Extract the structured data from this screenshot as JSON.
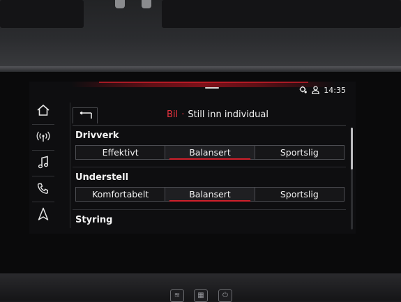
{
  "status": {
    "time": "14:35",
    "icons": [
      "gear-person-icon",
      "user-icon"
    ]
  },
  "sidebar": {
    "items": [
      {
        "name": "home",
        "icon": "home-icon"
      },
      {
        "name": "radio",
        "icon": "radio-signal-icon"
      },
      {
        "name": "media",
        "icon": "music-note-icon"
      },
      {
        "name": "phone",
        "icon": "phone-icon"
      },
      {
        "name": "navigation",
        "icon": "navigation-arrow-icon"
      }
    ]
  },
  "header": {
    "breadcrumb": "Bil",
    "separator": "·",
    "title": "Still inn individual",
    "back_icon": "back-arrow-icon"
  },
  "sections": [
    {
      "label": "Drivverk",
      "options": [
        "Effektivt",
        "Balansert",
        "Sportslig"
      ],
      "selected": "Balansert"
    },
    {
      "label": "Understell",
      "options": [
        "Komfortabelt",
        "Balansert",
        "Sportslig"
      ],
      "selected": "Balansert"
    },
    {
      "label": "Styring"
    }
  ],
  "colors": {
    "accent": "#d1202b",
    "crumb": "#e8333f",
    "background": "#0e0e10",
    "text": "#f2f2f2"
  }
}
